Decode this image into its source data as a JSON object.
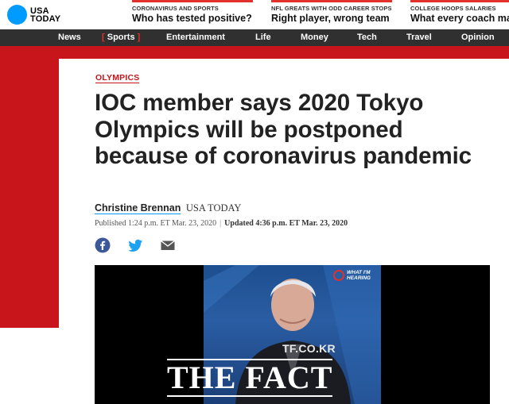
{
  "brand": {
    "logo_text_line1": "USA",
    "logo_text_line2": "TODAY",
    "accent": "#009bff",
    "red": "#c8151b"
  },
  "trending": [
    {
      "kicker": "CORONAVIRUS AND SPORTS",
      "headline": "Who has tested positive?"
    },
    {
      "kicker": "NFL GREATS WITH ODD CAREER STOPS",
      "headline": "Right player, wrong team"
    },
    {
      "kicker": "COLLEGE HOOPS SALARIES",
      "headline": "What every coach ma"
    }
  ],
  "nav": {
    "items": [
      "News",
      "Sports",
      "Entertainment",
      "Life",
      "Money",
      "Tech",
      "Travel",
      "Opinion"
    ],
    "active": "Sports"
  },
  "article": {
    "topic": "OLYMPICS",
    "headline": "IOC member says 2020 Tokyo Olympics will be postponed because of coronavirus pandemic",
    "author": "Christine Brennan",
    "outlet": "USA TODAY",
    "published": "Published 1:24 p.m. ET Mar. 23, 2020",
    "updated": "Updated 4:36 p.m. ET Mar. 23, 2020"
  },
  "share": [
    {
      "icon": "facebook-icon"
    },
    {
      "icon": "twitter-icon"
    },
    {
      "icon": "email-icon"
    }
  ],
  "video": {
    "badge_line1": "WHAT I'M",
    "badge_line2": "HEARING"
  },
  "watermark": {
    "small": "TF.CO.KR",
    "big": "THE FACT"
  }
}
